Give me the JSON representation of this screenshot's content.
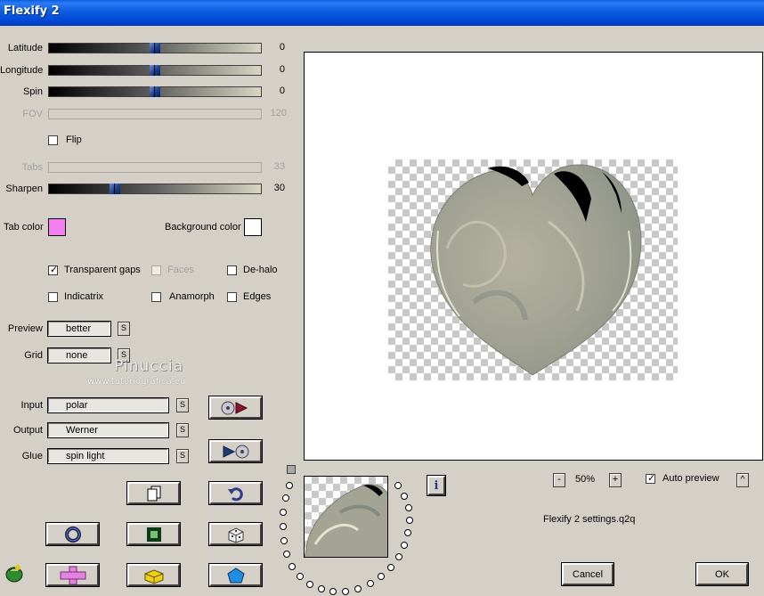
{
  "window": {
    "title": "Flexify 2"
  },
  "sliders": {
    "latitude": {
      "label": "Latitude",
      "value": "0",
      "level": 0.5
    },
    "longitude": {
      "label": "Longitude",
      "value": "0",
      "level": 0.5
    },
    "spin": {
      "label": "Spin",
      "value": "0",
      "level": 0.5
    },
    "fov": {
      "label": "FOV",
      "value": "120"
    },
    "tabs": {
      "label": "Tabs",
      "value": "33"
    },
    "sharpen": {
      "label": "Sharpen",
      "value": "30",
      "level": 0.3
    }
  },
  "checkboxes": {
    "flip": {
      "label": "Flip",
      "checked": false
    },
    "transparent_gaps": {
      "label": "Transparent gaps",
      "checked": true
    },
    "faces": {
      "label": "Faces",
      "checked": false
    },
    "de_halo": {
      "label": "De-halo",
      "checked": false
    },
    "indicatrix": {
      "label": "Indicatrix",
      "checked": false
    },
    "anamorph": {
      "label": "Anamorph",
      "checked": false
    },
    "edges": {
      "label": "Edges",
      "checked": false
    },
    "auto_preview": {
      "label": "Auto preview",
      "checked": true
    }
  },
  "colors": {
    "tab_color": {
      "label": "Tab color",
      "value": "#f57ef0"
    },
    "background_color": {
      "label": "Background color",
      "value": "#ffffff"
    }
  },
  "fields": {
    "preview": {
      "label": "Preview",
      "value": "better"
    },
    "grid": {
      "label": "Grid",
      "value": "none"
    },
    "input": {
      "label": "Input",
      "value": "polar"
    },
    "output": {
      "label": "Output",
      "value": "Werner"
    },
    "glue": {
      "label": "Glue",
      "value": "spin light"
    }
  },
  "small_button_label": "S",
  "watermark": {
    "name": "Pinuccia",
    "url": "www.tutoriografica.eu"
  },
  "zoom": {
    "minus": "-",
    "value": "50%",
    "plus": "+"
  },
  "settings_file": "Flexify 2 settings.q2q",
  "info_label": "i",
  "up_label": "^",
  "buttons": {
    "cancel": "Cancel",
    "ok": "OK"
  }
}
